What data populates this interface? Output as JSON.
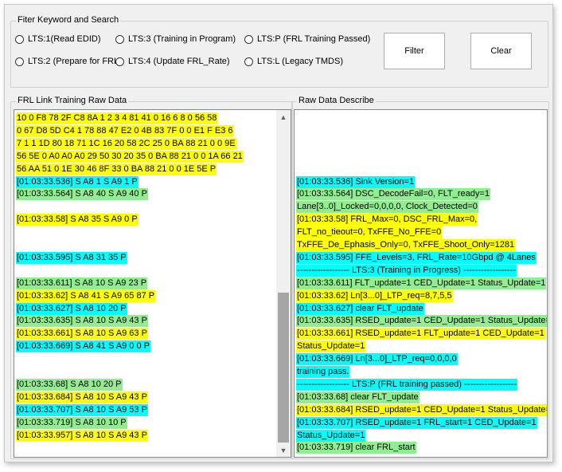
{
  "colors": {
    "yellow": "#ffff00",
    "cyan": "#00ffff",
    "green": "#90ee90",
    "window_bg": "#f0f0f0"
  },
  "filter": {
    "title": "Fiter Keyword and Search",
    "radios": [
      {
        "label": "LTS:1(Read EDID)",
        "checked": false
      },
      {
        "label": "LTS:3 (Training in Program)",
        "checked": false
      },
      {
        "label": "LTS:P (FRL Training Passed)",
        "checked": false
      },
      {
        "label": "LTS:2 (Prepare for FRL)",
        "checked": false
      },
      {
        "label": "LTS:4 (Update FRL_Rate)",
        "checked": false
      },
      {
        "label": "LTS:L (Legacy TMDS)",
        "checked": false
      }
    ],
    "filter_button": "Filter",
    "clear_button": "Clear"
  },
  "raw": {
    "title": "FRL Link Training Raw Data",
    "lines": [
      {
        "text": "10 0 F8 78 2F C8 8A 1 2 3 4 81 41 0 16 6 8 0 56 58",
        "color": "yellow"
      },
      {
        "text": "0 67 D8 5D C4 1 78 88 47 E2 0 4B 83 7F 0 0 E1 F E3 6",
        "color": "yellow"
      },
      {
        "text": "7 1 1 1D 80 18 71 1C 16 20 58 2C 25 0 BA 88 21 0 0 9E",
        "color": "yellow"
      },
      {
        "text": "56 5E 0 A0 A0 A0 29 50 30 20 35 0 BA 88 21 0 0 1A 66 21",
        "color": "yellow"
      },
      {
        "text": "56 AA 51 0 1E 30 46 8F 33 0 BA 88 21 0 0 1E 5E P",
        "color": "yellow"
      },
      {
        "text": "[01:03:33.536] S A8 1 S A9 1 P",
        "color": "cyan"
      },
      {
        "text": "[01:03:33.564] S A8 40 S A9 40 P",
        "color": "green"
      },
      {
        "text": "",
        "color": ""
      },
      {
        "text": "[01:03:33.58] S A8 35 S A9 0 P",
        "color": "yellow"
      },
      {
        "text": "",
        "color": ""
      },
      {
        "text": "",
        "color": ""
      },
      {
        "text": "[01:03:33.595] S A8 31 35 P",
        "color": "cyan"
      },
      {
        "text": "",
        "color": ""
      },
      {
        "text": "[01:03:33.611] S A8 10 S A9 23 P",
        "color": "green"
      },
      {
        "text": "[01:03:33.62] S A8 41 S A9 65 87 P",
        "color": "yellow"
      },
      {
        "text": "[01:03:33.627] S A8 10 20 P",
        "color": "cyan"
      },
      {
        "text": "[01:03:33.635] S A8 10 S A9 43 P",
        "color": "green"
      },
      {
        "text": "[01:03:33.661] S A8 10 S A9 63 P",
        "color": "yellow"
      },
      {
        "text": "[01:03:33.669] S A8 41 S A9 0 0 P",
        "color": "cyan"
      },
      {
        "text": "",
        "color": ""
      },
      {
        "text": "",
        "color": ""
      },
      {
        "text": "[01:03:33.68] S A8 10 20 P",
        "color": "green"
      },
      {
        "text": "[01:03:33.684] S A8 10 S A9 43 P",
        "color": "yellow"
      },
      {
        "text": "[01:03:33.707] S A8 10 S A9 53 P",
        "color": "cyan"
      },
      {
        "text": "[01:03:33.719] S A8 10 10 P",
        "color": "green"
      },
      {
        "text": "[01:03:33.957] S A8 10 S A9 43 P",
        "color": "yellow"
      }
    ]
  },
  "describe": {
    "title": "Raw Data Describe",
    "lines": [
      {
        "text": "",
        "color": ""
      },
      {
        "text": "",
        "color": ""
      },
      {
        "text": "",
        "color": ""
      },
      {
        "text": "",
        "color": ""
      },
      {
        "text": "",
        "color": ""
      },
      {
        "text": "[01:03:33.536] Sink Version=1",
        "color": "cyan"
      },
      {
        "text": "[01:03:33.564] DSC_DecodeFail=0, FLT_ready=1",
        "color": "green"
      },
      {
        "text": "Lane[3..0]_Locked=0,0,0,0, Clock_Detected=0",
        "color": "green"
      },
      {
        "text": "[01:03:33.58] FRL_Max=0, DSC_FRL_Max=0,",
        "color": "yellow"
      },
      {
        "text": "FLT_no_tieout=0, TxFFE_No_FFE=0",
        "color": "yellow"
      },
      {
        "text": "TxFFE_De_Ephasis_Only=0, TxFFE_Shoot_Only=1281",
        "color": "yellow"
      },
      {
        "text": "[01:03:33.595] FFE_Levels=3, FRL_Rate=10Gbpd @ 4Lanes",
        "color": "cyan"
      },
      {
        "text": "------------------ LTS:3 (Training in Progress) ------------------",
        "color": "cyan"
      },
      {
        "text": "[01:03:33.611] FLT_update=1 CED_Update=1 Status_Update=1",
        "color": "green"
      },
      {
        "text": "[01:03:33.62] Ln[3...0]_LTP_req=8,7,5,5",
        "color": "yellow"
      },
      {
        "text": "[01:03:33.627] clear FLT_update",
        "color": "cyan"
      },
      {
        "text": "[01:03:33.635] RSED_update=1 CED_Update=1 Status_Update=1",
        "color": "green"
      },
      {
        "text": "[01:03:33.661] RSED_update=1 FLT_update=1 CED_Update=1",
        "color": "yellow"
      },
      {
        "text": "Status_Update=1",
        "color": "yellow"
      },
      {
        "text": "[01:03:33.669] Ln[3...0]_LTP_req=0,0,0,0",
        "color": "cyan"
      },
      {
        "text": "training pass.",
        "color": "cyan"
      },
      {
        "text": "------------------ LTS:P (FRL training passed) ------------------",
        "color": "cyan"
      },
      {
        "text": "[01:03:33.68] clear FLT_update",
        "color": "green"
      },
      {
        "text": "[01:03:33.684] RSED_update=1 CED_Update=1 Status_Update=1",
        "color": "yellow"
      },
      {
        "text": "[01:03:33.707] RSED_update=1 FRL_start=1 CED_Update=1",
        "color": "cyan"
      },
      {
        "text": "Status_Update=1",
        "color": "cyan"
      },
      {
        "text": "[01:03:33.719] clear FRL_start",
        "color": "green"
      }
    ]
  },
  "icons": {
    "scroll_up": "▲",
    "scroll_down": "▼"
  }
}
